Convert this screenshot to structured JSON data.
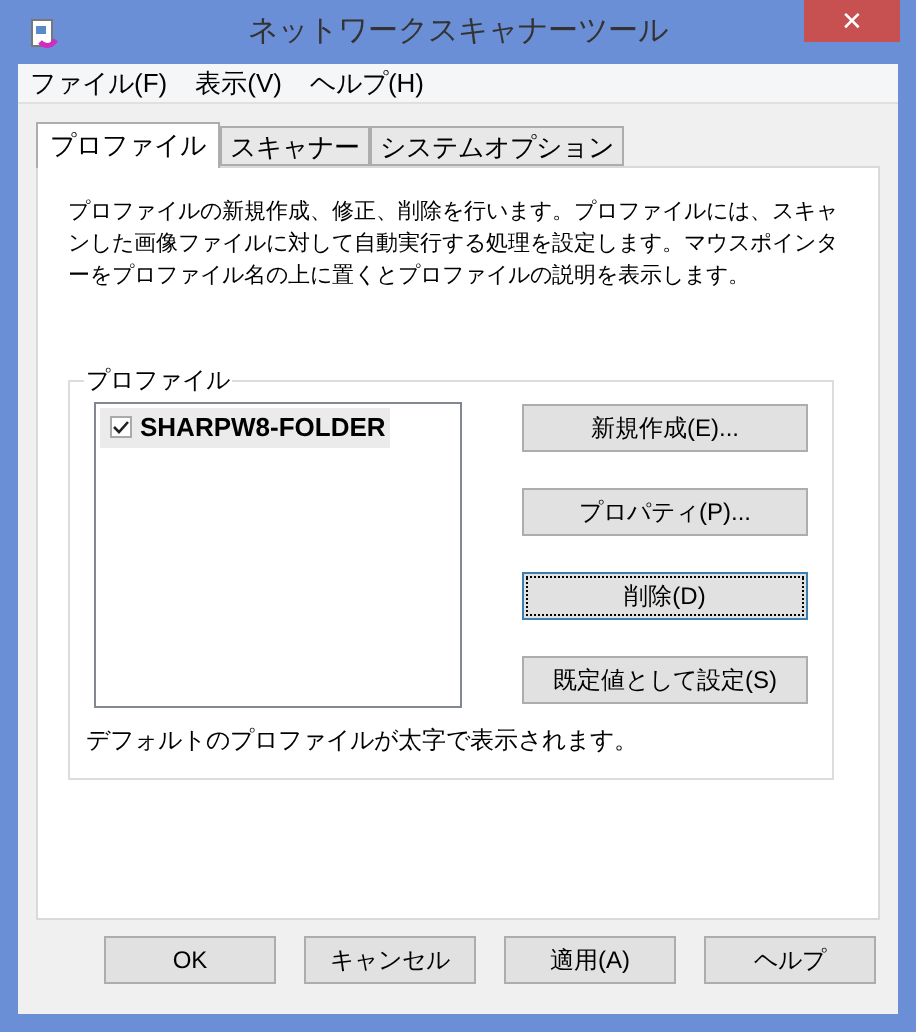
{
  "window": {
    "title": "ネットワークスキャナーツール",
    "close": "✕"
  },
  "menu": [
    "ファイル(F)",
    "表示(V)",
    "ヘルプ(H)"
  ],
  "tabs": [
    {
      "label": "プロファイル",
      "selected": true
    },
    {
      "label": "スキャナー",
      "selected": false
    },
    {
      "label": "システムオプション",
      "selected": false
    }
  ],
  "description": "プロファイルの新規作成、修正、削除を行います。プロファイルには、スキャンした画像ファイルに対して自動実行する処理を設定します。マウスポインターをプロファイル名の上に置くとプロファイルの説明を表示します。",
  "profiles": {
    "legend": "プロファイル",
    "items": [
      {
        "name": "SHARPW8-FOLDER",
        "checked": true,
        "default": true,
        "selected": true
      }
    ],
    "buttons": [
      {
        "label": "新規作成(E)...",
        "focused": false
      },
      {
        "label": "プロパティ(P)...",
        "focused": false
      },
      {
        "label": "削除(D)",
        "focused": true
      },
      {
        "label": "既定値として設定(S)",
        "focused": false
      }
    ],
    "note": "デフォルトのプロファイルが太字で表示されます。"
  },
  "footer_buttons": [
    "OK",
    "キャンセル",
    "適用(A)",
    "ヘルプ"
  ]
}
